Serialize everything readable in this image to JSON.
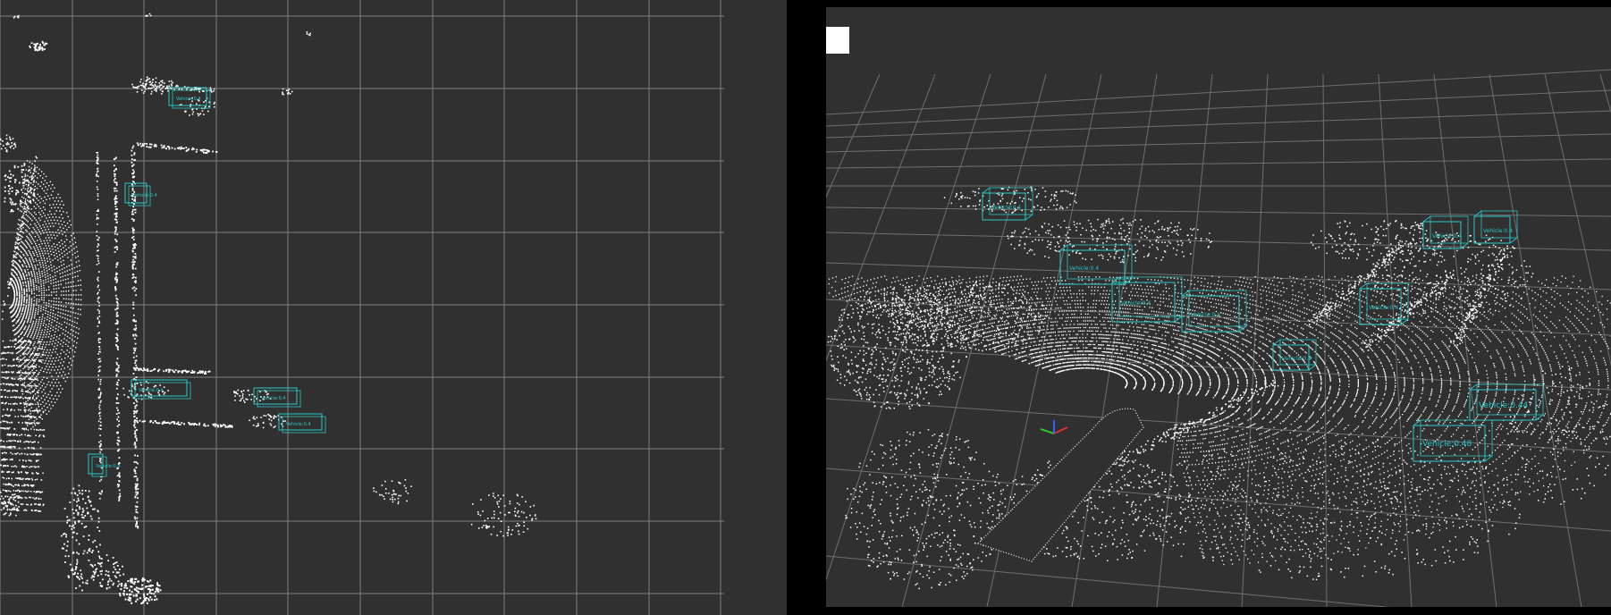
{
  "colors": {
    "background": "#303030",
    "grid": "#9a9a9a",
    "points": "#ffffff",
    "bbox": "#2cc8c8",
    "axis_x": "#e03030",
    "axis_y": "#30c030",
    "axis_z": "#3060ff"
  },
  "left_view": {
    "detections": [
      {
        "label": "Vehicle:0.4"
      },
      {
        "label": "Vehicle:0.4"
      },
      {
        "label": "Vehicle:0.4"
      },
      {
        "label": "Vehicle:0.4"
      },
      {
        "label": "Vehicle:0.4"
      },
      {
        "label": "Vehicle:0.4"
      }
    ]
  },
  "right_view": {
    "detections": [
      {
        "label": "Vehicle:0.4"
      },
      {
        "label": "Vehicle:0.4"
      },
      {
        "label": "Vehicle:0.4"
      },
      {
        "label": "Vehicle:0.4"
      },
      {
        "label": "Vehicle:0.4"
      },
      {
        "label": "Vehicle:0.4"
      },
      {
        "label": "Vehicle:0.4"
      },
      {
        "label": "Vehicle:0.4"
      },
      {
        "label": "Vehicle:0.44"
      },
      {
        "label": "Vehicle:0.48"
      }
    ]
  }
}
